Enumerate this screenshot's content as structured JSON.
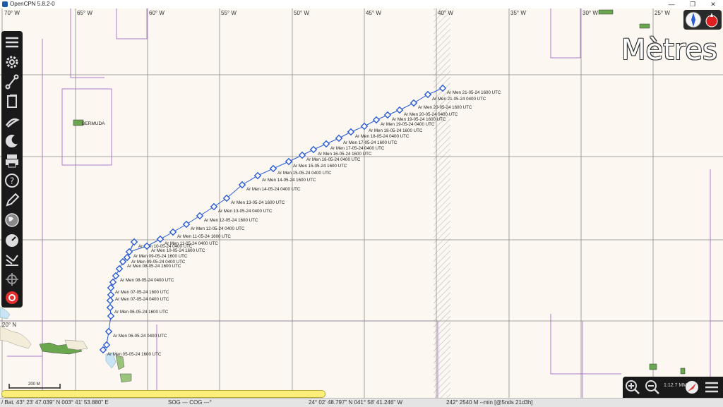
{
  "app": {
    "title": "OpenCPN 5.8.2-0"
  },
  "window_controls": {
    "minimize": "—",
    "maximize": "❐",
    "close": "✕"
  },
  "longitude_labels": [
    "70° W",
    "65° W",
    "60° W",
    "55° W",
    "50° W",
    "45° W",
    "40° W",
    "35° W",
    "30° W",
    "25° W"
  ],
  "latitude_labels": [
    "20° N"
  ],
  "places": {
    "bermuda": "BERMUDA"
  },
  "units_overlay": "Mètres",
  "track": {
    "color": "#2a5bd7",
    "points": [
      {
        "label": "Ar Men 05-05-24 1600 UTC"
      },
      {
        "label": ""
      },
      {
        "label": "Ar Men 06-05-24 0400 UTC"
      },
      {
        "label": ""
      },
      {
        "label": "Ar Men 06-05-24 1600 UTC"
      },
      {
        "label": ""
      },
      {
        "label": "Ar Men 07-05-24 0400 UTC"
      },
      {
        "label": "Ar Men 07-05-24 1600 UTC"
      },
      {
        "label": ""
      },
      {
        "label": "Ar Men 08-05-24 0400 UTC"
      },
      {
        "label": ""
      },
      {
        "label": "Ar Men 08-05-24 1600 UTC"
      },
      {
        "label": "Ar Men 09-05-24 0400 UTC"
      },
      {
        "label": "Ar Men 10-05-24 0400 UTC"
      },
      {
        "label": "Ar Men 09-05-24 1600 UTC"
      },
      {
        "label": "Ar Men 10-05-24 1600 UTC"
      },
      {
        "label": "Ar Men 11-05-24 0400 UTC"
      },
      {
        "label": "Ar Men 11-05-24 1600 UTC"
      },
      {
        "label": "Ar Men 12-05-24 0400 UTC"
      },
      {
        "label": "Ar Men 12-05-24 1600 UTC"
      },
      {
        "label": "Ar Men 13-05-24 0400 UTC"
      },
      {
        "label": "Ar Men 13-05-24 1600 UTC"
      },
      {
        "label": "Ar Men 14-05-24 0400 UTC"
      },
      {
        "label": "Ar Men 14-05-24 1600 UTC"
      },
      {
        "label": "Ar Men 15-05-24 0400 UTC"
      },
      {
        "label": "Ar Men 15-05-24 1600 UTC"
      },
      {
        "label": "Ar Men 16-05-24 0400 UTC"
      },
      {
        "label": "Ar Men 16-05-24 1600 UTC"
      },
      {
        "label": "Ar Men 17-05-24 0400 UTC"
      },
      {
        "label": "Ar Men 17-05-24 1600 UTC"
      },
      {
        "label": "Ar Men 18-05-24 0400 UTC"
      },
      {
        "label": "Ar Men 18-05-24 1600 UTC"
      },
      {
        "label": "Ar Men 19-05-24 0400 UTC"
      },
      {
        "label": "Ar Men 19-05-24 1600 UTC"
      },
      {
        "label": "Ar Men 20-05-24 0400 UTC"
      },
      {
        "label": "Ar Men 20-05-24 1600 UTC"
      },
      {
        "label": "Ar Men 21-05-24 0400 UTC"
      },
      {
        "label": "Ar Men 21-05-24 1600 UTC"
      }
    ]
  },
  "toolbar": {
    "icons": [
      "menu-icon",
      "settings-icon",
      "route-icon",
      "tracks-icon",
      "track-record-icon",
      "tides-currents-icon",
      "print-icon",
      "help-icon",
      "pencil-icon",
      "globe-icon",
      "dashboard-icon",
      "grib-icon",
      "ais-icon",
      "mob-icon"
    ]
  },
  "scale_bar": {
    "label": "200 M"
  },
  "status_bar": {
    "position": "/ Bat. 43° 23' 47.039\" N   003° 41' 53.880\" E",
    "sog_cog": "SOG --- COG ---°",
    "cursor": "24° 02' 48.797\" N   041° 58' 41.246\" W",
    "bearing": "242°   2540 M --min [@5nds 21d3h]"
  },
  "zoom": {
    "scale_text": "1:12.7 MM"
  }
}
